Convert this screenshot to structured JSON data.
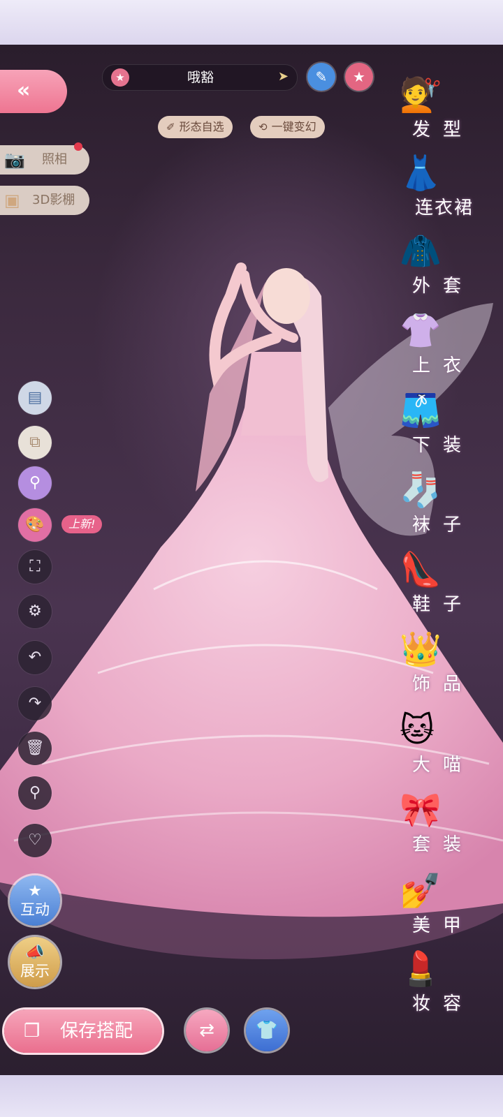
{
  "header": {
    "character_name": "哦豁"
  },
  "pills": {
    "pose_select": "形态自选",
    "transform": "一键变幻"
  },
  "left_menu": {
    "photo": "照相",
    "studio_3d": "3D影棚",
    "new_badge": "上新!"
  },
  "big_buttons": {
    "interact": "互动",
    "showcase": "展示"
  },
  "bottom": {
    "save_outfit": "保存搭配"
  },
  "categories": [
    {
      "label": "发型",
      "icon": "hair-icon"
    },
    {
      "label": "连衣裙",
      "icon": "dress-icon"
    },
    {
      "label": "外套",
      "icon": "coat-icon"
    },
    {
      "label": "上衣",
      "icon": "shirt-icon"
    },
    {
      "label": "下装",
      "icon": "shorts-icon"
    },
    {
      "label": "袜子",
      "icon": "sock-icon"
    },
    {
      "label": "鞋子",
      "icon": "shoe-icon"
    },
    {
      "label": "饰品",
      "icon": "tiara-icon"
    },
    {
      "label": "大喵",
      "icon": "cat-icon"
    },
    {
      "label": "套装",
      "icon": "outfit-set-icon"
    },
    {
      "label": "美甲",
      "icon": "nail-polish-icon"
    },
    {
      "label": "妆容",
      "icon": "makeup-icon"
    }
  ],
  "colors": {
    "accent_pink": "#ee7591",
    "pill_beige": "#e4cdbe",
    "blue": "#4a8fe0"
  }
}
